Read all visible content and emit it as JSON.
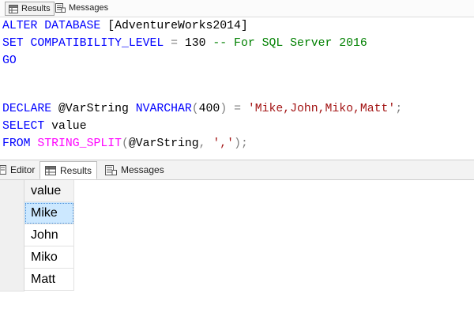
{
  "top_tabs": {
    "results_label": "Results",
    "messages_label": "Messages"
  },
  "editor": {
    "lines": [
      [
        {
          "t": "ALTER DATABASE ",
          "c": "kw"
        },
        {
          "t": "[AdventureWorks2014]",
          "c": "plain"
        }
      ],
      [
        {
          "t": "SET COMPATIBILITY_LEVEL ",
          "c": "kw"
        },
        {
          "t": "= ",
          "c": "op"
        },
        {
          "t": "130 ",
          "c": "plain"
        },
        {
          "t": "-- For SQL Server 2016",
          "c": "cmt"
        }
      ],
      [
        {
          "t": "GO",
          "c": "kw"
        }
      ],
      [],
      [],
      [
        {
          "t": "DECLARE ",
          "c": "kw"
        },
        {
          "t": "@VarString ",
          "c": "plain"
        },
        {
          "t": "NVARCHAR",
          "c": "kw"
        },
        {
          "t": "(",
          "c": "op"
        },
        {
          "t": "400",
          "c": "plain"
        },
        {
          "t": ") = ",
          "c": "op"
        },
        {
          "t": "'Mike,John,Miko,Matt'",
          "c": "str"
        },
        {
          "t": ";",
          "c": "op"
        }
      ],
      [
        {
          "t": "SELECT ",
          "c": "kw"
        },
        {
          "t": "value",
          "c": "plain"
        }
      ],
      [
        {
          "t": "FROM ",
          "c": "kw"
        },
        {
          "t": "STRING_SPLIT",
          "c": "fn"
        },
        {
          "t": "(",
          "c": "op"
        },
        {
          "t": "@VarString",
          "c": "plain"
        },
        {
          "t": ", ",
          "c": "op"
        },
        {
          "t": "','",
          "c": "str"
        },
        {
          "t": ");",
          "c": "op"
        }
      ]
    ]
  },
  "bottom_tabs": {
    "editor_label": "Editor",
    "results_label": "Results",
    "messages_label": "Messages"
  },
  "grid": {
    "column_header": "value",
    "rows": [
      "Mike",
      "John",
      "Miko",
      "Matt"
    ],
    "selected_row": 0
  }
}
